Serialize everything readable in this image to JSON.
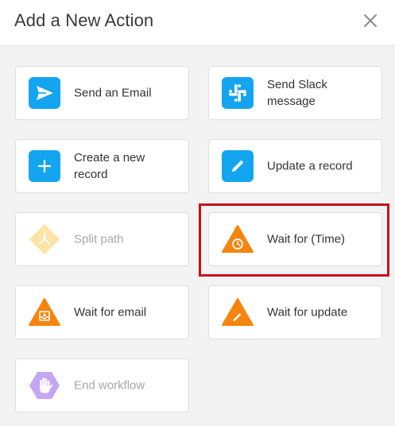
{
  "dialog": {
    "title": "Add a New Action",
    "close_icon": "close-icon"
  },
  "actions": [
    {
      "label": "Send an Email",
      "icon": "paper-plane-icon",
      "color": "#13a5ef",
      "disabled": false
    },
    {
      "label": "Send Slack message",
      "icon": "slack-icon",
      "color": "#13a5ef",
      "disabled": false
    },
    {
      "label": "Create a new record",
      "icon": "plus-icon",
      "color": "#13a5ef",
      "disabled": false
    },
    {
      "label": "Update a record",
      "icon": "pencil-icon",
      "color": "#13a5ef",
      "disabled": false
    },
    {
      "label": "Split path",
      "icon": "split-path-icon",
      "color": "#fde3a6",
      "disabled": true
    },
    {
      "label": "Wait for (Time)",
      "icon": "clock-icon",
      "color": "#f5850f",
      "disabled": false,
      "highlighted": true
    },
    {
      "label": "Wait for email",
      "icon": "email-tray-icon",
      "color": "#f5850f",
      "disabled": false
    },
    {
      "label": "Wait for update",
      "icon": "pencil-icon",
      "color": "#f5850f",
      "disabled": false
    },
    {
      "label": "End workflow",
      "icon": "hand-icon",
      "color": "#c4a6f5",
      "disabled": true
    }
  ],
  "colors": {
    "blue": "#13a5ef",
    "orange": "#f5850f",
    "disabled_yellow": "#fde3a6",
    "disabled_purple": "#c4a6f5",
    "highlight_border": "#c8101a"
  }
}
